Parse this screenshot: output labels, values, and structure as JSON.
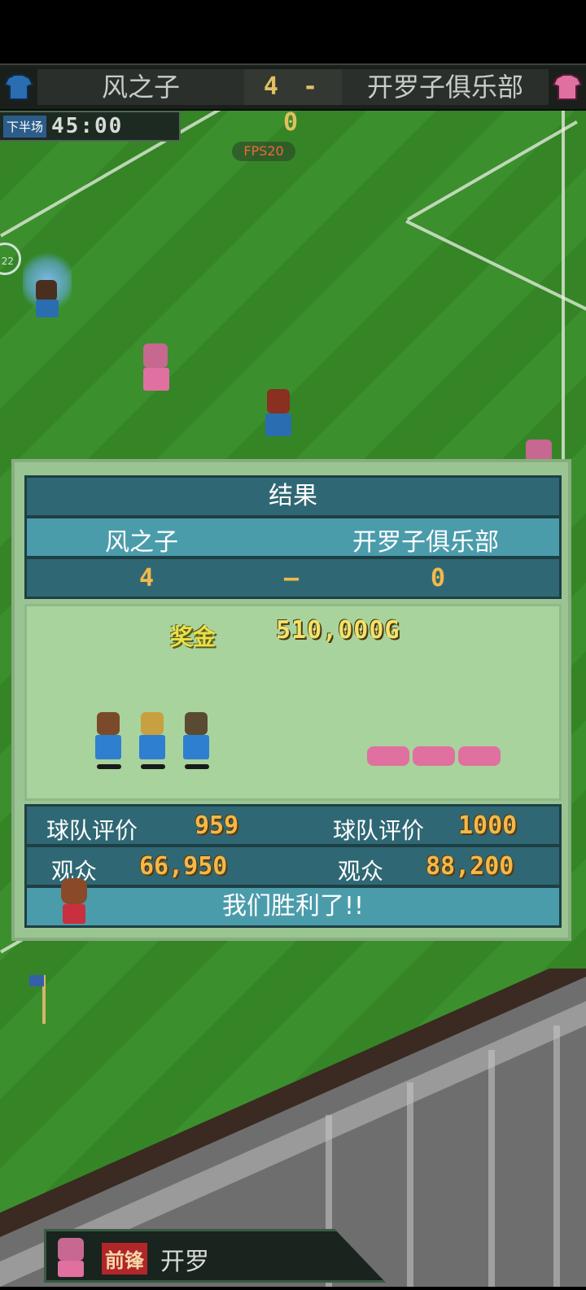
{
  "scoreboard": {
    "home_team": "风之子",
    "away_team": "开罗子俱乐部",
    "score": "4 - 0",
    "period": "下半场",
    "clock": "45:00",
    "fps": "FPS20",
    "left_marker": "22",
    "home_color": "#2a6db0",
    "away_color": "#e070a0"
  },
  "result": {
    "title": "结果",
    "home_team": "风之子",
    "away_team": "开罗子俱乐部",
    "home_score": "4",
    "dash": "–",
    "away_score": "0",
    "prize_label": "奖金",
    "prize_value": "510,000G",
    "home_rating_label": "球队评价",
    "home_rating": "959",
    "away_rating_label": "球队评价",
    "away_rating": "1000",
    "home_audience_label": "观众",
    "home_audience": "66,950",
    "away_audience_label": "观众",
    "away_audience": "88,200",
    "message": "我们胜利了!!"
  },
  "bottom": {
    "badge": "前锋",
    "player": "开罗"
  }
}
